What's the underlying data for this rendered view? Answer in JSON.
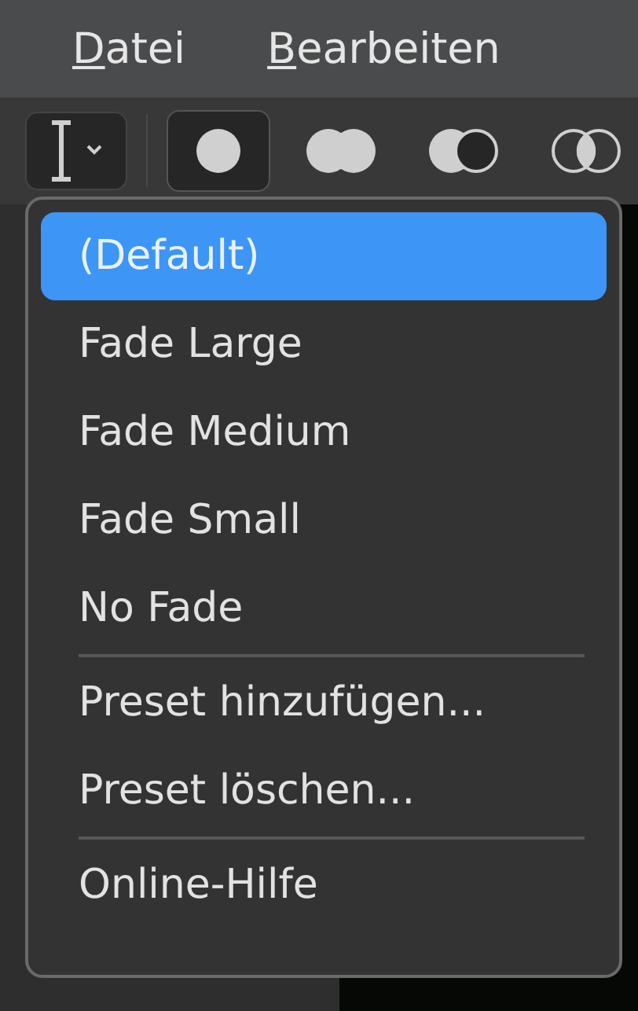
{
  "menu_bar": [
    {
      "label": "Datei",
      "mnemonic_underlined": true
    },
    {
      "label": "Bearbeiten",
      "mnemonic_underlined": true
    }
  ],
  "toolbar": {
    "tool_dropdown": {
      "expanded": true
    },
    "brush_modes": [
      {
        "kind": "solid",
        "selected": true
      },
      {
        "kind": "double",
        "selected": false
      },
      {
        "kind": "toggle",
        "selected": false
      },
      {
        "kind": "intersect",
        "selected": false
      }
    ]
  },
  "preset_menu": [
    {
      "kind": "item",
      "label": "(Default)",
      "selected": true
    },
    {
      "kind": "item",
      "label": "Fade Large",
      "selected": false
    },
    {
      "kind": "item",
      "label": "Fade Medium",
      "selected": false
    },
    {
      "kind": "item",
      "label": "Fade Small",
      "selected": false
    },
    {
      "kind": "item",
      "label": "No Fade",
      "selected": false
    },
    {
      "kind": "separator"
    },
    {
      "kind": "item",
      "label": "Preset hinzufügen...",
      "selected": false
    },
    {
      "kind": "item",
      "label": "Preset löschen...",
      "selected": false
    },
    {
      "kind": "separator"
    },
    {
      "kind": "item",
      "label": "Online-Hilfe",
      "selected": false
    }
  ]
}
